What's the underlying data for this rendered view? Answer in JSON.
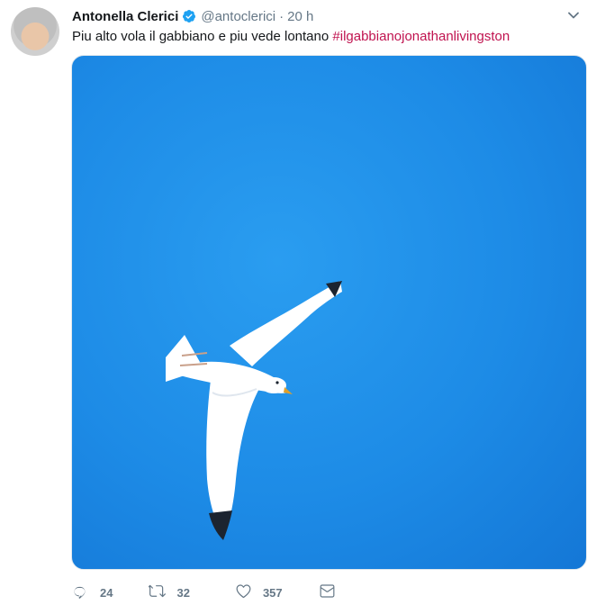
{
  "tweet": {
    "author_name": "Antonella Clerici",
    "handle": "@antoclerici",
    "separator": "·",
    "time": "20 h",
    "text": "Piu alto vola il gabbiano e piu vede lontano",
    "hashtag": "#ilgabbianojonathanlivingston"
  },
  "actions": {
    "replies": "24",
    "retweets": "32",
    "likes": "357"
  },
  "icons": {
    "verified": "verified-badge-icon",
    "more": "chevron-down-icon",
    "reply": "reply-icon",
    "retweet": "retweet-icon",
    "like": "heart-icon",
    "message": "envelope-icon"
  },
  "colors": {
    "hashtag": "#c0134f",
    "verified": "#1da1f2",
    "sky": "#1d8be6",
    "secondary_text": "#657786"
  }
}
